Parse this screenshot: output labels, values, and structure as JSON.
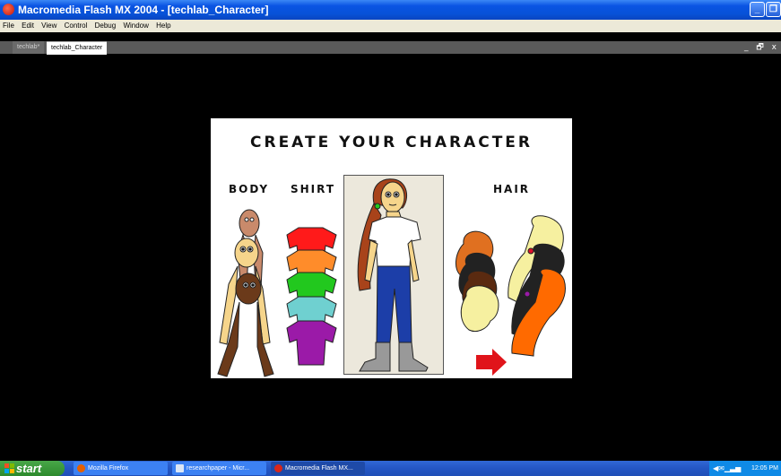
{
  "window": {
    "title": "Macromedia Flash MX 2004 - [techlab_Character]",
    "min_icon": "minimize-icon",
    "max_icon": "restore-icon",
    "close_icon": "close-icon"
  },
  "menu": [
    "File",
    "Edit",
    "View",
    "Control",
    "Debug",
    "Window",
    "Help"
  ],
  "tabs": [
    {
      "label": "techlab*",
      "active": false
    },
    {
      "label": "techlab_Character",
      "active": true
    }
  ],
  "doc_controls": "_ &#x1F5D7; x",
  "stage": {
    "title": "CREATE YOUR CHARACTER",
    "categories": {
      "body": "BODY",
      "shirt": "SHIRT",
      "hair": "HAIR"
    },
    "body_tones": [
      "#c98a6b",
      "#f6d58b",
      "#6b3a1a"
    ],
    "shirt_colors": [
      "#ff1a1a",
      "#ff8c2a",
      "#22c81e",
      "#6fd0d0",
      "#9b1aa8"
    ],
    "hair_colors": [
      "#e07020",
      "#222222",
      "#5a2a10",
      "#f6f0a0",
      "#ff6a00"
    ],
    "next_icon": "red-arrow-right-icon"
  },
  "taskbar": {
    "start": "start",
    "tasks": [
      {
        "label": "Mozilla Firefox",
        "icon": "firefox-icon",
        "active": false
      },
      {
        "label": "researchpaper - Micr...",
        "icon": "word-icon",
        "active": false
      },
      {
        "label": "Macromedia Flash MX...",
        "icon": "flash-icon",
        "active": true
      }
    ],
    "clock": "12:05 PM"
  },
  "colors": {
    "titlebar": "#0a54e3",
    "taskbar": "#2456c4",
    "start": "#3a9a3a",
    "stage_bg": "#ffffff",
    "workspace": "#000000"
  }
}
